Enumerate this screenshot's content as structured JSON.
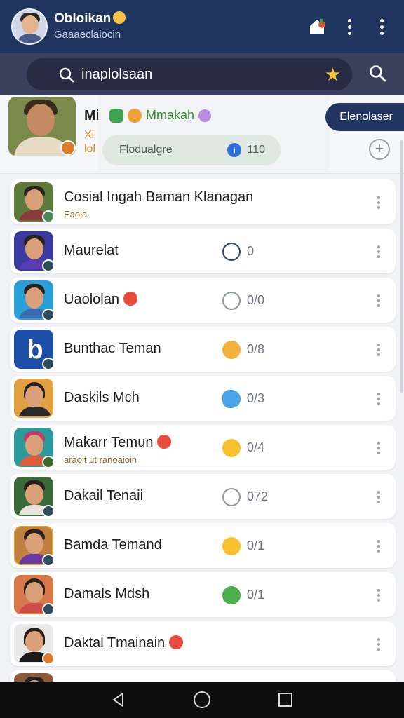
{
  "header": {
    "title": "Obloikan",
    "subtitle": "Gaaaeclaiocin",
    "icons": [
      "avatar",
      "home-badge-icon",
      "more-vertical-icon",
      "more-vertical-icon"
    ]
  },
  "search": {
    "query": "inaplolsaan",
    "favorite_icon": "star-icon",
    "right_icon": "search-icon"
  },
  "profile": {
    "name": "Mi",
    "line1": "Xi",
    "line2": "lol",
    "tag_title": "Mmakah",
    "pill_label": "Flodualgre",
    "pill_value": "110",
    "cta_label": "Elenolaser",
    "add_icon": "+"
  },
  "contacts": [
    {
      "name": "Cosial Ingah Baman Klanagan",
      "sub": "Eaoia",
      "status": "",
      "count": "",
      "heart": false,
      "avatar": "person"
    },
    {
      "name": "Maurelat",
      "sub": "",
      "status": "outline",
      "count": "0",
      "heart": false,
      "avatar": "person"
    },
    {
      "name": "Uaololan",
      "sub": "",
      "status": "grey",
      "count": "0/0",
      "heart": true,
      "avatar": "person"
    },
    {
      "name": "Bunthac Teman",
      "sub": "",
      "status": "duck",
      "count": "0/8",
      "heart": false,
      "avatar": "letter-b"
    },
    {
      "name": "Daskils Mch",
      "sub": "",
      "status": "bird",
      "count": "0/3",
      "heart": false,
      "avatar": "person"
    },
    {
      "name": "Makarr Temun",
      "sub": "araoit ut ranoaioin",
      "status": "yellow",
      "count": "0/4",
      "heart": true,
      "avatar": "person"
    },
    {
      "name": "Dakail Tenaii",
      "sub": "",
      "status": "grey",
      "count": "072",
      "heart": false,
      "avatar": "person"
    },
    {
      "name": "Bamda Temand",
      "sub": "",
      "status": "yellow",
      "count": "0/1",
      "heart": false,
      "avatar": "person"
    },
    {
      "name": "Damals Mdsh",
      "sub": "",
      "status": "green",
      "count": "0/1",
      "heart": false,
      "avatar": "person"
    },
    {
      "name": "Daktal Tmainain",
      "sub": "",
      "status": "",
      "count": "",
      "heart": true,
      "avatar": "person"
    }
  ],
  "navbar": {
    "icons": [
      "back-icon",
      "home-icon",
      "recents-icon"
    ]
  },
  "colors": {
    "header_bg": "#1f3560",
    "search_bg": "#3a3f5c",
    "accent": "#1f3560"
  }
}
